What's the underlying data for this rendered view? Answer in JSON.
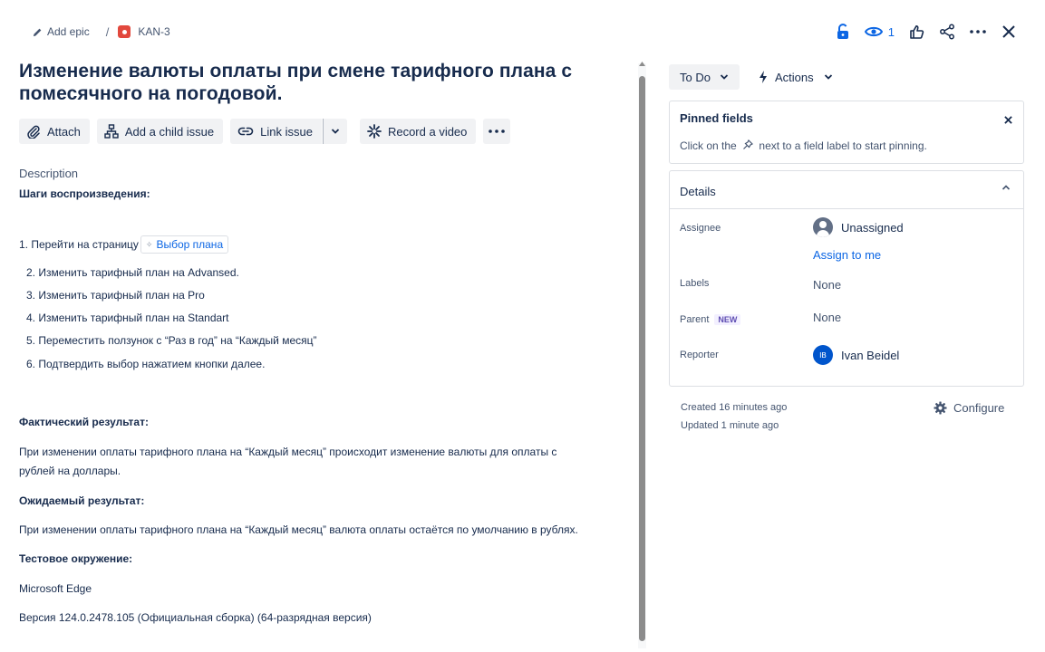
{
  "breadcrumb": {
    "add_epic": "Add epic",
    "separator": "/",
    "issue_key": "KAN-3"
  },
  "header": {
    "watch_count": "1"
  },
  "issue": {
    "title": "Изменение валюты оплаты при смене тарифного плана с помесячного на погодовой."
  },
  "toolbar": {
    "attach": "Attach",
    "add_child": "Add a child issue",
    "link_issue": "Link issue",
    "record_video": "Record a video"
  },
  "description": {
    "label": "Description",
    "steps_heading": "Шаги воспроизведения:",
    "step1_text": "1. Перейти на страницу",
    "step1_link": "Выбор плана",
    "steps": [
      "2. Изменить тарифный план на Advansed.",
      "3. Изменить тарифный план на Pro",
      "4. Изменить тарифный план на Standart",
      "5. Переместить ползунок с  “Раз в год” на “Каждый месяц”",
      "6. Подтвердить выбор нажатием кнопки далее."
    ],
    "actual_heading": "Фактический результат:",
    "actual_line1": "При изменении оплаты тарифного плана на “Каждый месяц”  происходит изменение валюты для оплаты с",
    "actual_line2": "рублей на доллары.",
    "expected_heading": "Ожидаемый результат:",
    "expected_text": "При изменении оплаты тарифного плана на “Каждый месяц” валюта оплаты остаётся по умолчанию в рублях.",
    "env_heading": "Тестовое окружение:",
    "env_browser": "Microsoft Edge",
    "env_version": "Версия 124.0.2478.105 (Официальная сборка) (64-разрядная версия)"
  },
  "status": {
    "label": "To Do",
    "actions": "Actions"
  },
  "pinned": {
    "title": "Pinned fields",
    "hint_before": "Click on the",
    "hint_after": "next to a field label to start pinning."
  },
  "details": {
    "title": "Details",
    "assignee_label": "Assignee",
    "assignee_value": "Unassigned",
    "assign_to_me": "Assign to me",
    "labels_label": "Labels",
    "labels_value": "None",
    "parent_label": "Parent",
    "parent_badge": "NEW",
    "parent_value": "None",
    "reporter_label": "Reporter",
    "reporter_initials": "IB",
    "reporter_value": "Ivan Beidel"
  },
  "meta": {
    "created": "Created 16 minutes ago",
    "updated": "Updated 1 minute ago",
    "configure": "Configure"
  },
  "colors": {
    "accent": "#0c66e4",
    "issue_type": "#e2483d",
    "button_bg": "#f1f2f4",
    "text": "#172b4d"
  }
}
